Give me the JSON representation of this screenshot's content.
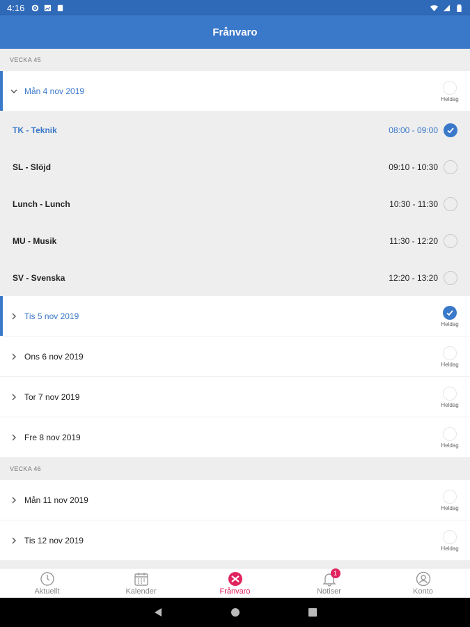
{
  "status": {
    "time": "4:16"
  },
  "header": {
    "title": "Frånvaro"
  },
  "heldag_label": "Heldag",
  "weeks": [
    {
      "label": "VECKA 45",
      "days": [
        {
          "label": "Mån 4 nov 2019",
          "expanded": true,
          "checked": false,
          "lessons": [
            {
              "name": "TK - Teknik",
              "time": "08:00 - 09:00",
              "checked": true
            },
            {
              "name": "SL - Slöjd",
              "time": "09:10 - 10:30",
              "checked": false
            },
            {
              "name": "Lunch - Lunch",
              "time": "10:30 - 11:30",
              "checked": false
            },
            {
              "name": "MU - Musik",
              "time": "11:30 - 12:20",
              "checked": false
            },
            {
              "name": "SV - Svenska",
              "time": "12:20 - 13:20",
              "checked": false
            }
          ]
        },
        {
          "label": "Tis 5 nov 2019",
          "checked": true
        },
        {
          "label": "Ons 6 nov 2019",
          "checked": false
        },
        {
          "label": "Tor 7 nov 2019",
          "checked": false
        },
        {
          "label": "Fre 8 nov 2019",
          "checked": false
        }
      ]
    },
    {
      "label": "VECKA 46",
      "days": [
        {
          "label": "Mån 11 nov 2019",
          "checked": false
        },
        {
          "label": "Tis 12 nov 2019",
          "checked": false
        }
      ]
    }
  ],
  "tabs": [
    {
      "label": "Aktuellt",
      "icon": "clock-icon"
    },
    {
      "label": "Kalender",
      "icon": "calendar-icon"
    },
    {
      "label": "Frånvaro",
      "icon": "absence-icon",
      "active": true
    },
    {
      "label": "Notiser",
      "icon": "bell-icon",
      "badge": "1"
    },
    {
      "label": "Konto",
      "icon": "account-icon"
    }
  ],
  "colors": {
    "primary": "#3a78c9",
    "accent": "#e0245e"
  }
}
